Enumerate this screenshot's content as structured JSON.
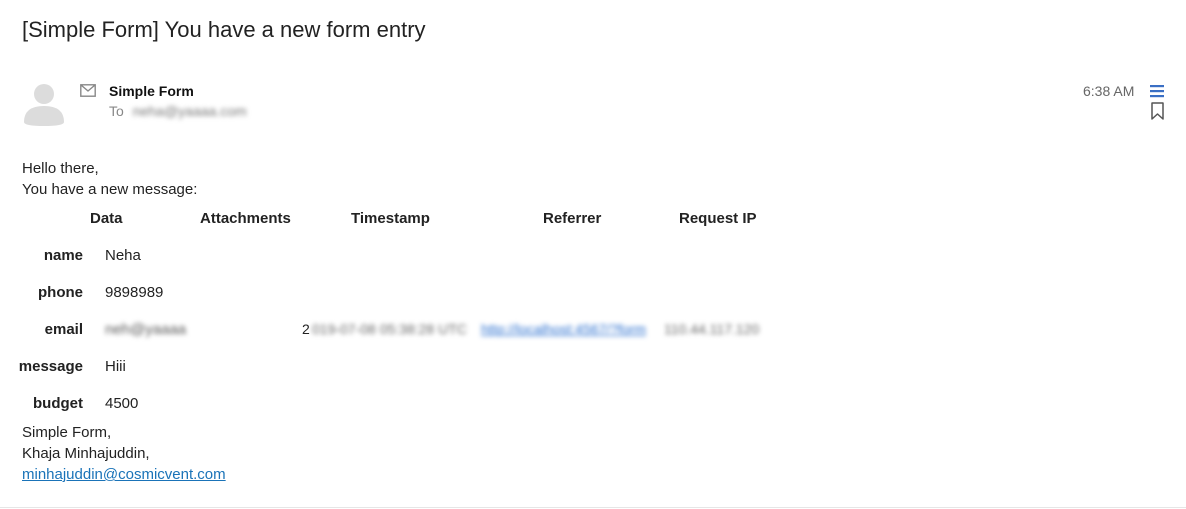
{
  "email": {
    "subject": "[Simple Form] You have a new form entry",
    "sender_name": "Simple Form",
    "to_label": "To",
    "to_address_redacted": "neha@yaaaa.com",
    "time": "6:38 AM",
    "icons": {
      "avatar": "person-silhouette-icon",
      "envelope": "envelope-icon",
      "menu": "hamburger-menu-icon",
      "bookmark": "bookmark-icon"
    },
    "accent_color": "#3a6fc4"
  },
  "body": {
    "greeting": "Hello there,",
    "intro": "You have a new message:",
    "table": {
      "headers": [
        "Data",
        "Attachments",
        "Timestamp",
        "Referrer",
        "Request IP"
      ],
      "fields": [
        {
          "label": "name",
          "value": "Neha"
        },
        {
          "label": "phone",
          "value": "9898989"
        },
        {
          "label": "email",
          "value": "neh@yaaaa"
        },
        {
          "label": "message",
          "value": "Hiii"
        },
        {
          "label": "budget",
          "value": "4500"
        }
      ],
      "timestamp_first": "2",
      "timestamp_rest": "019-07-08 05:38:28 UTC",
      "referrer": "http://localhost:4567/?form",
      "request_ip": "110.44.117.120"
    },
    "signature": {
      "line1": "Simple Form,",
      "line2": "Khaja Minhajuddin,",
      "link": "minhajuddin@cosmicvent.com"
    }
  }
}
